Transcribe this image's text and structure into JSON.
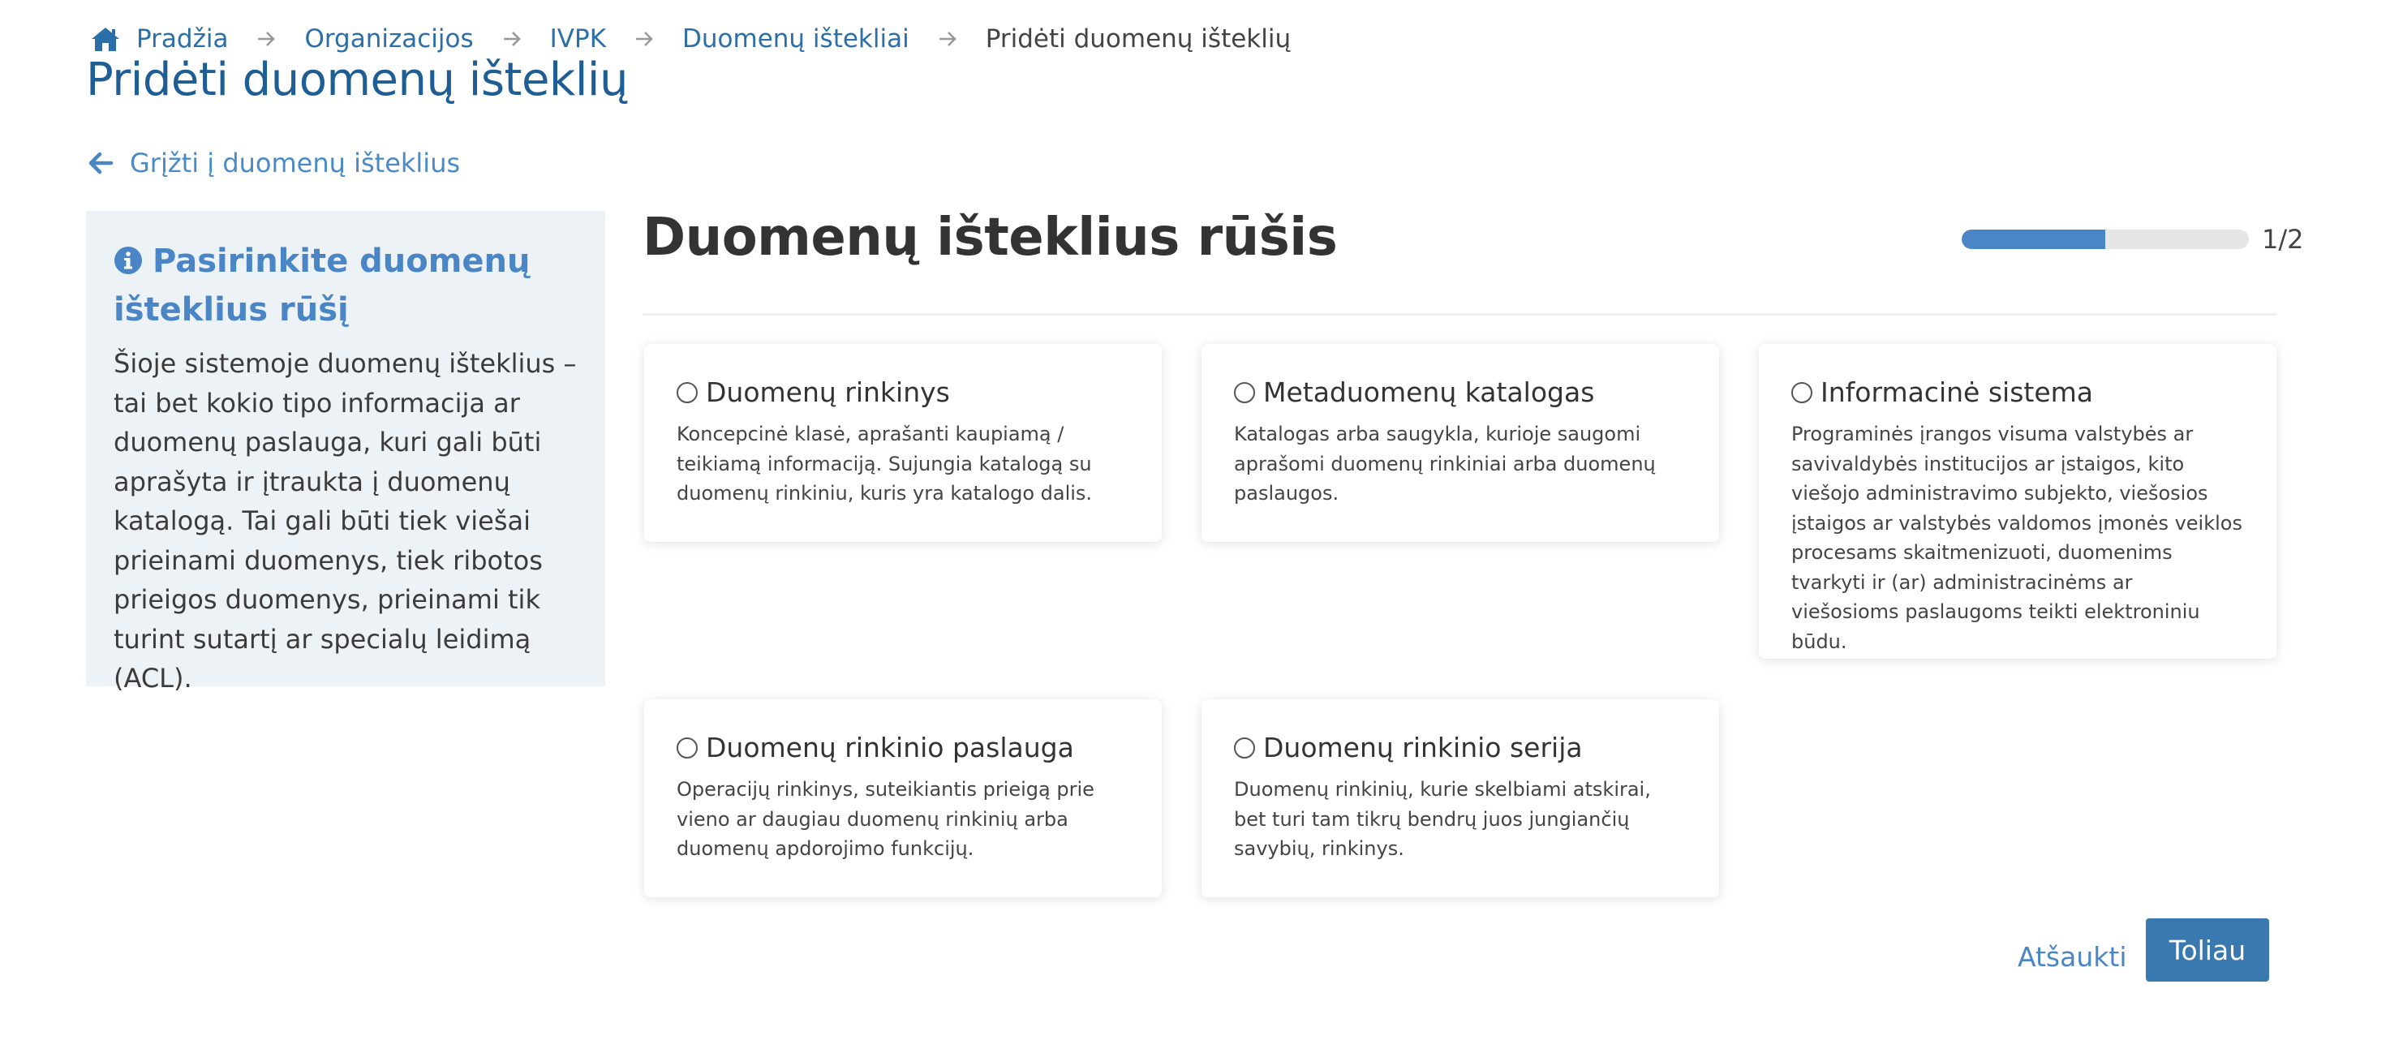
{
  "breadcrumb": {
    "home_label": "Pradžia",
    "items": [
      "Organizacijos",
      "IVPK",
      "Duomenų ištekliai"
    ],
    "current": "Pridėti duomenų išteklių"
  },
  "page": {
    "title": "Pridėti duomenų išteklių",
    "back_link": "Grįžti į duomenų išteklius"
  },
  "info": {
    "title": "Pasirinkite duomenų išteklius rūšį",
    "text": "Šioje sistemoje duomenų išteklius – tai bet kokio tipo informacija ar duomenų paslauga, kuri gali būti aprašyta ir įtraukta į duomenų katalogą. Tai gali būti tiek viešai prieinami duomenys, tiek ribotos prieigos duomenys, prieinami tik turint sutartį ar specialų leidimą (ACL)."
  },
  "section": {
    "title": "Duomenų išteklius rūšis",
    "progress_label": "1/2",
    "progress_fraction": 0.5
  },
  "options": [
    {
      "title": "Duomenų rinkinys",
      "description": "Koncepcinė klasė, aprašanti kaupiamą / teikiamą informaciją. Sujungia katalogą su duomenų rinkiniu, kuris yra katalogo dalis."
    },
    {
      "title": "Metaduomenų katalogas",
      "description": "Katalogas arba saugykla, kurioje saugomi aprašomi duomenų rinkiniai arba duomenų paslaugos."
    },
    {
      "title": "Informacinė sistema",
      "description": "Programinės įrangos visuma valstybės ar savivaldybės institucijos ar įstaigos, kito viešojo administravimo subjekto, viešosios įstaigos ar valstybės valdomos įmonės veiklos procesams skaitmenizuoti, duomenims tvarkyti ir (ar) administracinėms ar viešosioms paslaugoms teikti elektroniniu būdu."
    },
    {
      "title": "Duomenų rinkinio paslauga",
      "description": "Operacijų rinkinys, suteikiantis prieigą prie vieno ar daugiau duomenų rinkinių arba duomenų apdorojimo funkcijų."
    },
    {
      "title": "Duomenų rinkinio serija",
      "description": "Duomenų rinkinių, kurie skelbiami atskirai, bet turi tam tikrų bendrų juos jungiančių savybių, rinkinys."
    }
  ],
  "actions": {
    "cancel": "Atšaukti",
    "next": "Toliau"
  },
  "colors": {
    "primary": "#3a78b0",
    "link": "#4a86c5",
    "title_blue": "#1f5d95",
    "panel_bg": "#edf2f7"
  }
}
